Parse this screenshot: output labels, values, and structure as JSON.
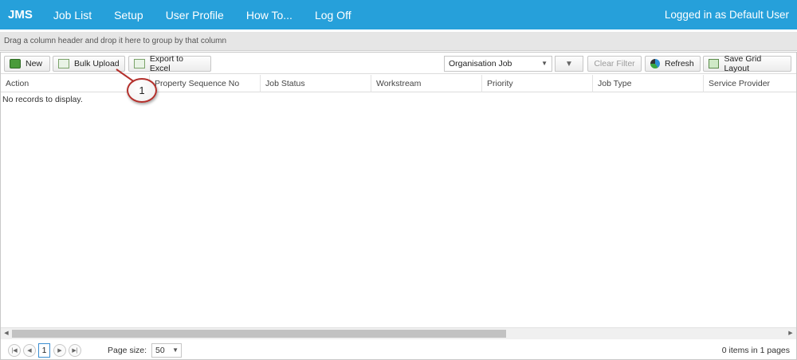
{
  "navbar": {
    "brand": "JMS",
    "items": [
      "Job List",
      "Setup",
      "User Profile",
      "How To...",
      "Log Off"
    ],
    "user_text": "Logged in as Default User"
  },
  "group_panel": {
    "hint": "Drag a column header and drop it here to group by that column"
  },
  "toolbar": {
    "new_label": "New",
    "bulk_upload_label": "Bulk Upload",
    "export_label": "Export to Excel",
    "view_select_value": "Organisation Job",
    "clear_filter_label": "Clear Filter",
    "refresh_label": "Refresh",
    "save_layout_label": "Save Grid Layout"
  },
  "grid": {
    "columns": [
      "Action",
      "Property Sequence No",
      "Job Status",
      "Workstream",
      "Priority",
      "Job Type",
      "Service Provider"
    ],
    "empty_message": "No records to display."
  },
  "pager": {
    "current_page": "1",
    "page_size_label": "Page size:",
    "page_size_value": "50",
    "info": "0 items in 1 pages"
  },
  "annotation": {
    "callout_number": "1"
  },
  "colors": {
    "navbar_bg": "#26a0da",
    "callout_border": "#b4302c"
  }
}
